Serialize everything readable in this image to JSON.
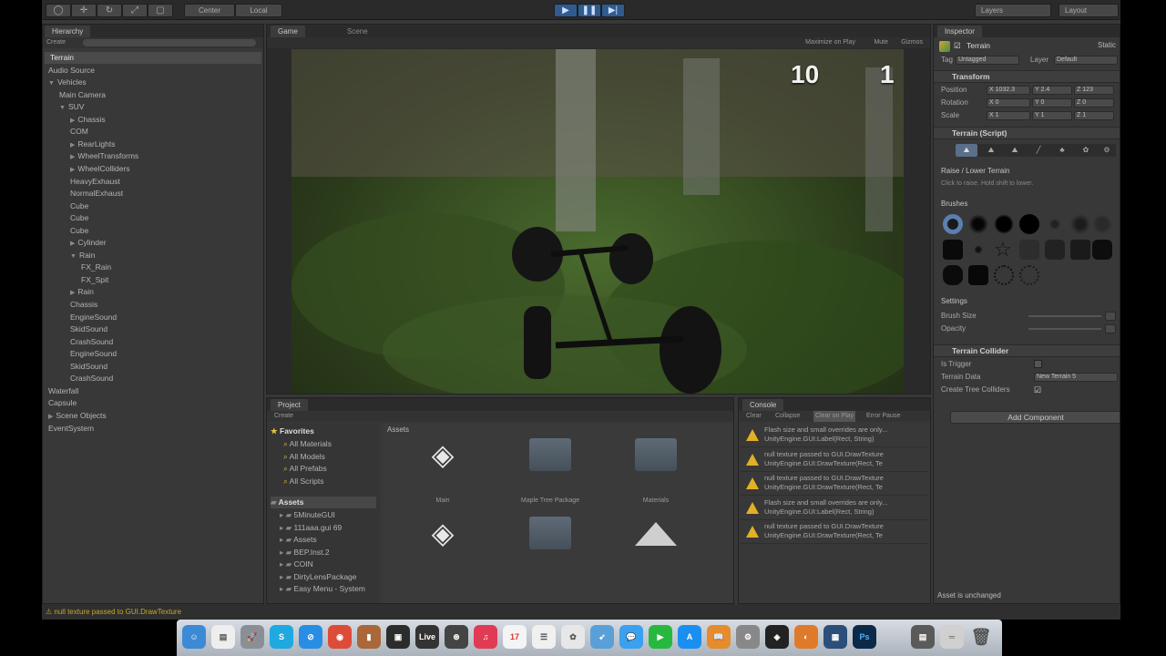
{
  "toolbar": {
    "center_label": "Center",
    "local_label": "Local",
    "layers_label": "Layers",
    "layout_label": "Layout"
  },
  "hierarchy": {
    "tab": "Hierarchy",
    "create_label": "Create",
    "items": [
      {
        "label": "Terrain",
        "indent": 0,
        "arrow": "",
        "selected": true
      },
      {
        "label": "Audio Source",
        "indent": 0,
        "arrow": ""
      },
      {
        "label": "Vehicles",
        "indent": 0,
        "arrow": "▼"
      },
      {
        "label": "Main Camera",
        "indent": 1,
        "arrow": ""
      },
      {
        "label": "SUV",
        "indent": 1,
        "arrow": "▼"
      },
      {
        "label": "Chassis",
        "indent": 2,
        "arrow": "▶"
      },
      {
        "label": "COM",
        "indent": 2,
        "arrow": ""
      },
      {
        "label": "RearLights",
        "indent": 2,
        "arrow": "▶"
      },
      {
        "label": "WheelTransforms",
        "indent": 2,
        "arrow": "▶"
      },
      {
        "label": "WheelColliders",
        "indent": 2,
        "arrow": "▶"
      },
      {
        "label": "HeavyExhaust",
        "indent": 2,
        "arrow": ""
      },
      {
        "label": "NormalExhaust",
        "indent": 2,
        "arrow": ""
      },
      {
        "label": "Cube",
        "indent": 2,
        "arrow": ""
      },
      {
        "label": "Cube",
        "indent": 2,
        "arrow": ""
      },
      {
        "label": "Cube",
        "indent": 2,
        "arrow": ""
      },
      {
        "label": "Cylinder",
        "indent": 2,
        "arrow": "▶"
      },
      {
        "label": "Rain",
        "indent": 2,
        "arrow": "▼"
      },
      {
        "label": "FX_Rain",
        "indent": 3,
        "arrow": ""
      },
      {
        "label": "FX_Spit",
        "indent": 3,
        "arrow": ""
      },
      {
        "label": "Rain",
        "indent": 2,
        "arrow": "▶"
      },
      {
        "label": "Chassis",
        "indent": 2,
        "arrow": ""
      },
      {
        "label": "EngineSound",
        "indent": 2,
        "arrow": ""
      },
      {
        "label": "SkidSound",
        "indent": 2,
        "arrow": ""
      },
      {
        "label": "CrashSound",
        "indent": 2,
        "arrow": ""
      },
      {
        "label": "EngineSound",
        "indent": 2,
        "arrow": ""
      },
      {
        "label": "SkidSound",
        "indent": 2,
        "arrow": ""
      },
      {
        "label": "CrashSound",
        "indent": 2,
        "arrow": ""
      },
      {
        "label": "Waterfall",
        "indent": 0,
        "arrow": ""
      },
      {
        "label": "Capsule",
        "indent": 0,
        "arrow": ""
      },
      {
        "label": "Scene Objects",
        "indent": 0,
        "arrow": "▶"
      },
      {
        "label": "EventSystem",
        "indent": 0,
        "arrow": ""
      }
    ]
  },
  "game": {
    "tab_game": "Game",
    "tab_scene": "Scene",
    "maximize_label": "Maximize on Play",
    "mute_label": "Mute",
    "gizmos_label": "Gizmos",
    "score_left": "10",
    "score_right": "1"
  },
  "project": {
    "tab": "Project",
    "create_label": "Create",
    "favorites_label": "Favorites",
    "favorites": [
      "All Materials",
      "All Models",
      "All Prefabs",
      "All Scripts"
    ],
    "assets_label": "Assets",
    "asset_folders": [
      "5MinuteGUI",
      "111aaa.gui 69",
      "Assets",
      "BEP.Inst.2",
      "COIN",
      "DirtyLensPackage",
      "Easy Menu - System"
    ],
    "breadcrumb": "Assets",
    "grid": [
      {
        "label": "Main",
        "kind": "unity"
      },
      {
        "label": "Maple Tree Package",
        "kind": "folder"
      },
      {
        "label": "Materials",
        "kind": "folder"
      },
      {
        "label": "",
        "kind": "unity"
      },
      {
        "label": "",
        "kind": "folder"
      },
      {
        "label": "",
        "kind": "terrain"
      }
    ]
  },
  "console": {
    "tab": "Console",
    "clear": "Clear",
    "collapse": "Collapse",
    "clear_on_play": "Clear on Play",
    "error_pause": "Error Pause",
    "rows": [
      {
        "line1": "Flash size and small overrides are only...",
        "line2": "UnityEngine.GUI:Label(Rect, String)"
      },
      {
        "line1": "null texture passed to GUI.DrawTexture",
        "line2": "UnityEngine.GUI:DrawTexture(Rect, Te"
      },
      {
        "line1": "null texture passed to GUI.DrawTexture",
        "line2": "UnityEngine.GUI:DrawTexture(Rect, Te"
      },
      {
        "line1": "Flash size and small overrides are only...",
        "line2": "UnityEngine.GUI:Label(Rect, String)"
      },
      {
        "line1": "null texture passed to GUI.DrawTexture",
        "line2": "UnityEngine.GUI:DrawTexture(Rect, Te"
      }
    ]
  },
  "inspector": {
    "tab": "Inspector",
    "object_name": "Terrain",
    "static_label": "Static",
    "tag_label": "Tag",
    "tag_value": "Untagged",
    "layer_label": "Layer",
    "layer_value": "Default",
    "transform_title": "Transform",
    "position_label": "Position",
    "rotation_label": "Rotation",
    "scale_label": "Scale",
    "position": {
      "x": "X 1032.3",
      "y": "Y 2.4",
      "z": "Z 123"
    },
    "rotation": {
      "x": "X 0",
      "y": "Y 0",
      "z": "Z 0"
    },
    "scale": {
      "x": "X 1",
      "y": "Y 1",
      "z": "Z 1"
    },
    "terrain_script_title": "Terrain (Script)",
    "tool_title": "Raise / Lower Terrain",
    "tool_hint": "Click to raise. Hold shift to lower.",
    "brushes_label": "Brushes",
    "settings_label": "Settings",
    "brush_size_label": "Brush Size",
    "opacity_label": "Opacity",
    "collider_title": "Terrain Collider",
    "is_trigger_label": "Is Trigger",
    "terrain_data_label": "Terrain Data",
    "terrain_data_value": "New Terrain 5",
    "create_tree_colliders_label": "Create Tree Colliders",
    "add_component_label": "Add Component",
    "asset_status": "Asset is unchanged"
  },
  "status_bar": {
    "message": "null texture passed to GUI.DrawTexture"
  },
  "colors": {
    "editor_bg": "#383838",
    "warning": "#e0b026",
    "selection": "#4a4a4a",
    "play_blue": "#2f5b8f"
  }
}
